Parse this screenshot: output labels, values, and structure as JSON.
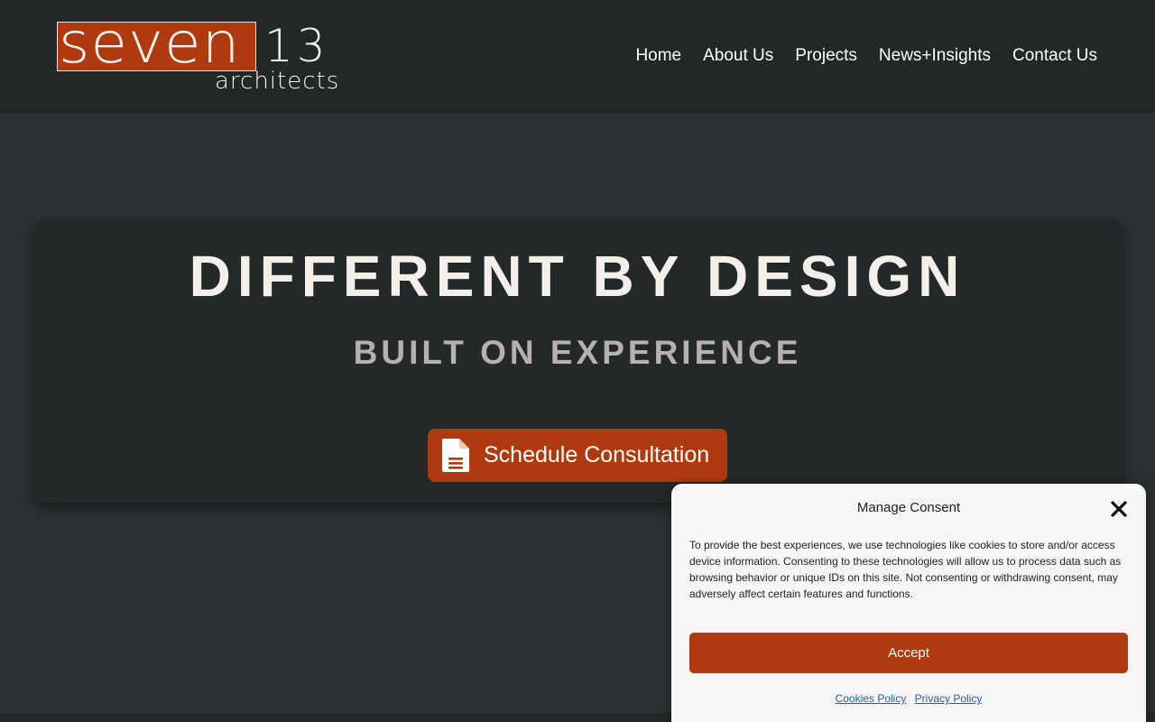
{
  "logo": {
    "word": "seven",
    "number": "13",
    "sub": "architects",
    "brand_color": "#b03a0f"
  },
  "nav": {
    "items": [
      {
        "label": "Home"
      },
      {
        "label": "About Us"
      },
      {
        "label": "Projects"
      },
      {
        "label": "News+Insights"
      },
      {
        "label": "Contact Us"
      }
    ]
  },
  "hero": {
    "title": "DIFFERENT BY DESIGN",
    "subtitle": "BUILT ON EXPERIENCE",
    "cta_label": "Schedule Consultation",
    "cta_icon": "document-icon"
  },
  "consent": {
    "title": "Manage Consent",
    "close_icon": "close-icon",
    "text": "To provide the best experiences, we use technologies like cookies to store and/or access device information. Consenting to these technologies will allow us to process data such as browsing behavior or unique IDs on this site. Not consenting or withdrawing consent, may adversely affect certain features and functions.",
    "accept_label": "Accept",
    "links": [
      {
        "label": "Cookies Policy"
      },
      {
        "label": "Privacy Policy"
      }
    ]
  }
}
